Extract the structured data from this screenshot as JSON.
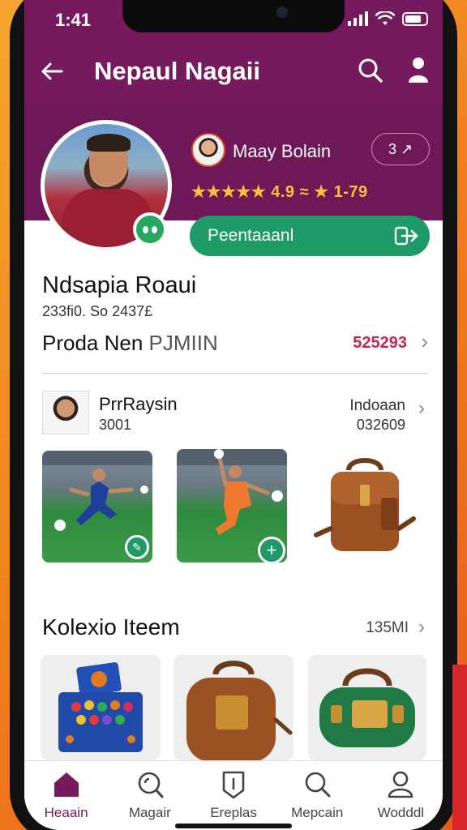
{
  "status_bar": {
    "time": "1:41"
  },
  "topbar": {
    "title": "Nepaul Nagaii"
  },
  "profile": {
    "secondary_name": "Maay Bolain",
    "follow_pill": "3 ↗",
    "rating_text": "★★★★★ 4.9 ≈ ★ 1-79",
    "action_button": "Peentaaanl"
  },
  "section": {
    "title": "Ndsapia Roaui",
    "subtitle": "233fi0. So 2437£",
    "product_label": "Proda Nen",
    "product_label_suffix": "PJMIIN",
    "product_value": "525293"
  },
  "player": {
    "name": "PrrRaysin",
    "number": "3001",
    "right_label": "Indoaan",
    "right_number": "032609"
  },
  "collection": {
    "title": "Kolexio Iteem",
    "count": "135MI"
  },
  "bottom_nav": [
    {
      "label": "Heaain",
      "icon": "home-icon",
      "active": true
    },
    {
      "label": "Magair",
      "icon": "magnify-icon",
      "active": false
    },
    {
      "label": "Ereplas",
      "icon": "shield-icon",
      "active": false
    },
    {
      "label": "Mepcain",
      "icon": "search-icon",
      "active": false
    },
    {
      "label": "Wodddl",
      "icon": "profile-icon",
      "active": false
    }
  ],
  "colors": {
    "header": "#741a5d",
    "accent_green": "#1e9a67",
    "rating_gold": "#f4c23b",
    "value_red": "#c3264f"
  }
}
